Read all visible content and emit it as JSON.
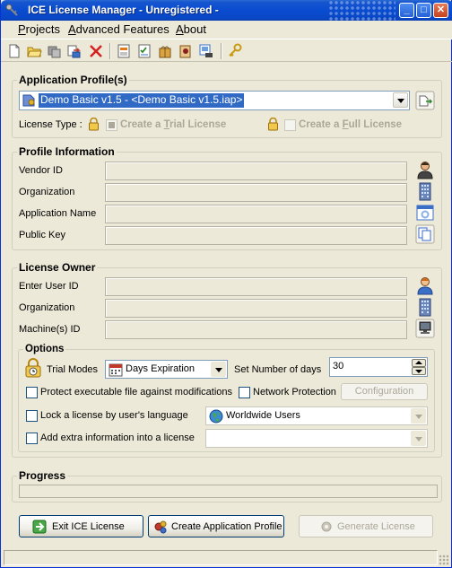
{
  "window": {
    "title": "ICE License Manager  - Unregistered -",
    "minimize": "_",
    "maximize": "□",
    "close": "✕"
  },
  "menu": {
    "projects": {
      "ul": "P",
      "rest": "rojects"
    },
    "advanced": {
      "ul": "A",
      "rest": "dvanced Features"
    },
    "about": {
      "ul": "A",
      "rest": "bout"
    }
  },
  "toolbar": {
    "icons": [
      "new-document-icon",
      "open-folder-icon",
      "copy-icon",
      "export-icon",
      "delete-icon",
      "report-icon",
      "checklist-icon",
      "gift-package-icon",
      "settings-icon",
      "preview-icon",
      "key-icon"
    ]
  },
  "app_profiles": {
    "title": "Application Profile(s)",
    "selected": "Demo Basic v1.5 - <Demo Basic v1.5.iap>",
    "license_type_label": "License Type :",
    "trial": {
      "pre": "Create a ",
      "ul": "T",
      "rest": "rial License"
    },
    "full": {
      "pre": "Create a ",
      "ul": "F",
      "rest": "ull License"
    }
  },
  "profile_info": {
    "title": "Profile Information",
    "vendor_id": "Vendor ID",
    "organization": "Organization",
    "application_name": "Application Name",
    "public_key": "Public Key"
  },
  "license_owner": {
    "title": "License Owner",
    "enter_user_id": "Enter User ID",
    "organization": "Organization",
    "machine_id": "Machine(s) ID"
  },
  "options": {
    "title": "Options",
    "trial_modes_label": "Trial Modes",
    "trial_mode_value": "Days Expiration",
    "set_days_label": "Set Number of days",
    "days_value": "30",
    "protect_exe": "Protect executable file against modifications",
    "network_protection": "Network Protection",
    "configuration": "Configuration",
    "lock_language": "Lock a license by user's language",
    "language_value": "Worldwide Users",
    "extra_info": "Add extra information into a license"
  },
  "progress": {
    "title": "Progress",
    "value": 0
  },
  "buttons": {
    "exit": "Exit ICE License",
    "create_profile": "Create Application Profile",
    "generate": "Generate License"
  },
  "colors": {
    "titlebar": "#0a4cd0",
    "selection": "#316ac5",
    "window_bg": "#ece9d8"
  }
}
